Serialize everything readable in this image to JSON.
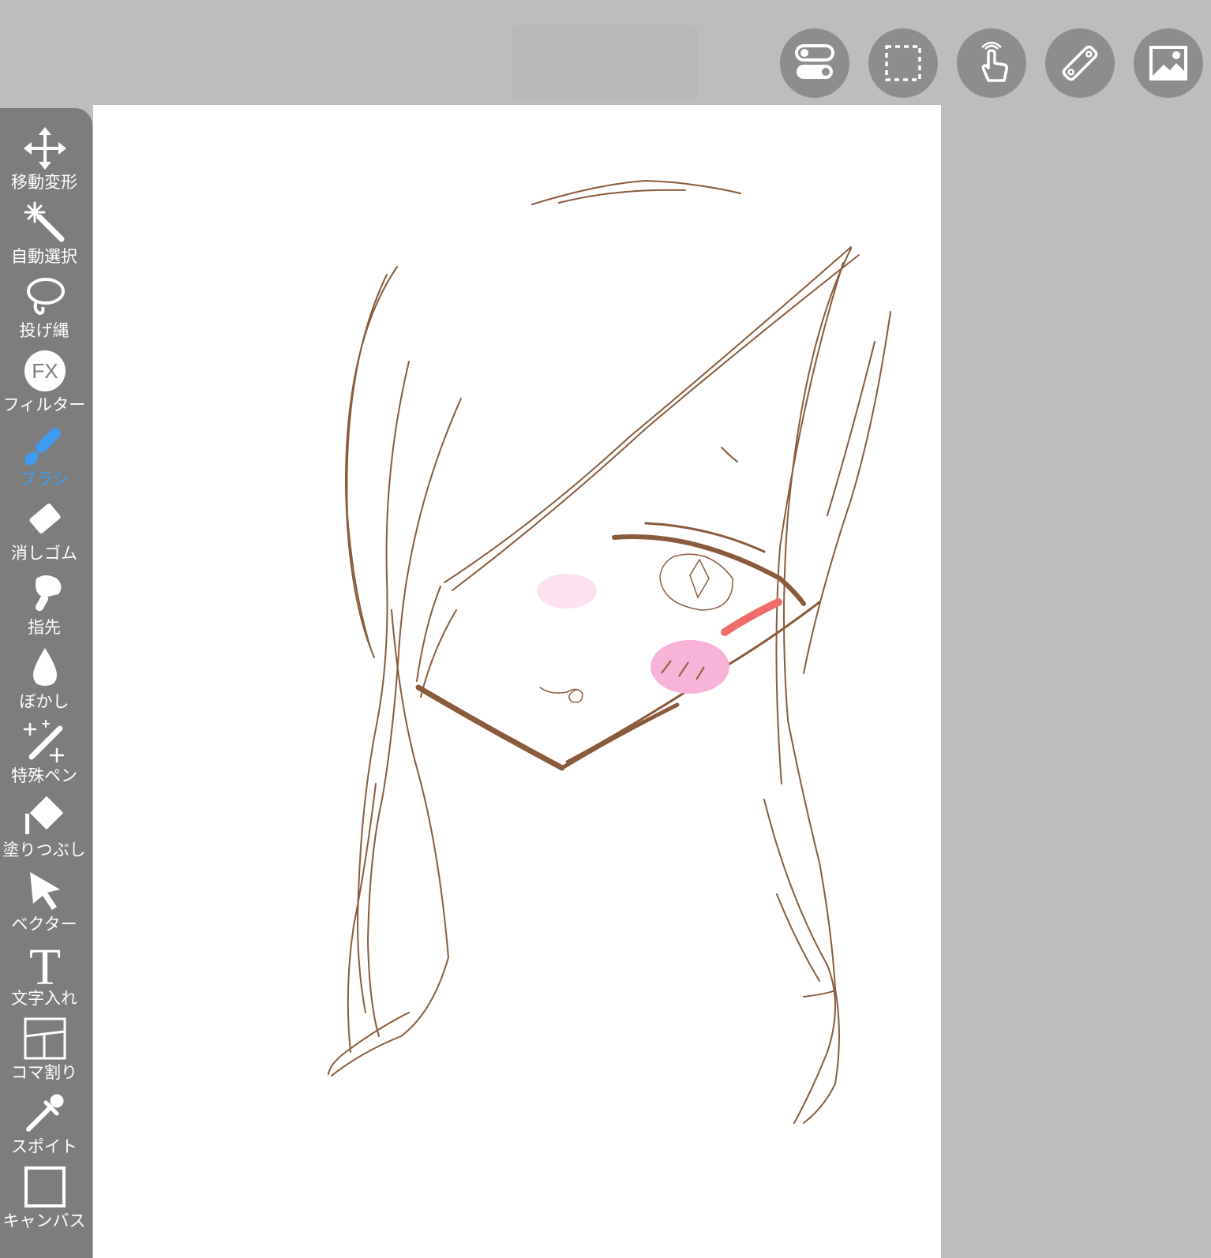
{
  "app": {
    "colors": {
      "background": "#bdbdbd",
      "toolbar": "#7d7d7d",
      "toolbar_button": "#8d8d8d",
      "canvas": "#ffffff",
      "active_tool": "#3d9cf0",
      "stroke_brown": "#8a5a3c",
      "blush_pink": "#f7b3d8",
      "eye_accent_red": "#f26b6b"
    }
  },
  "top_bar": {
    "buttons": [
      {
        "name": "layer-toggle-button",
        "icon": "toggle-icon"
      },
      {
        "name": "selection-button",
        "icon": "dashed-select-icon"
      },
      {
        "name": "gesture-button",
        "icon": "hand-touch-icon"
      },
      {
        "name": "ruler-button",
        "icon": "ruler-icon"
      },
      {
        "name": "image-button",
        "icon": "image-icon"
      }
    ]
  },
  "toolbar": {
    "active": "ブラシ",
    "tools": [
      {
        "label": "移動変形",
        "icon": "move-arrows-icon"
      },
      {
        "label": "自動選択",
        "icon": "magic-wand-icon"
      },
      {
        "label": "投げ縄",
        "icon": "lasso-icon"
      },
      {
        "label": "フィルター",
        "icon": "fx-icon",
        "icon_text": "FX"
      },
      {
        "label": "ブラシ",
        "icon": "brush-icon"
      },
      {
        "label": "消しゴム",
        "icon": "eraser-icon"
      },
      {
        "label": "指先",
        "icon": "finger-smudge-icon"
      },
      {
        "label": "ぼかし",
        "icon": "blur-drop-icon"
      },
      {
        "label": "特殊ペン",
        "icon": "special-pen-icon"
      },
      {
        "label": "塗りつぶし",
        "icon": "fill-bucket-icon"
      },
      {
        "label": "ベクター",
        "icon": "vector-cursor-icon"
      },
      {
        "label": "文字入れ",
        "icon": "text-icon",
        "icon_text": "T"
      },
      {
        "label": "コマ割り",
        "icon": "panel-frame-icon"
      },
      {
        "label": "スポイト",
        "icon": "eyedropper-icon"
      },
      {
        "label": "キャンバス",
        "icon": "canvas-square-icon"
      }
    ]
  }
}
